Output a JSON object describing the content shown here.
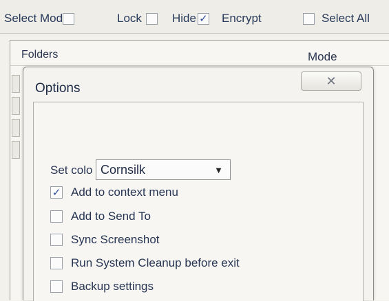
{
  "toolbar": {
    "items": [
      {
        "label": "Select Mod",
        "checked": false
      },
      {
        "label": "Lock",
        "checked": false
      },
      {
        "label": "Hide",
        "checked": true
      },
      {
        "label": "Encrypt",
        "checked": false
      },
      {
        "label": "Select All",
        "checked": false
      }
    ]
  },
  "table": {
    "col_folders": "Folders",
    "col_mode": "Mode"
  },
  "dialog": {
    "title": "Options",
    "close_glyph": "✕",
    "set_color_label": "Set colo",
    "color_value": "Cornsilk",
    "options": [
      {
        "label": "Add to context menu",
        "checked": true
      },
      {
        "label": "Add to Send To",
        "checked": false
      },
      {
        "label": "Sync Screenshot",
        "checked": false
      },
      {
        "label": "Run System Cleanup before exit",
        "checked": false
      },
      {
        "label": "Backup settings",
        "checked": false
      }
    ]
  },
  "check_glyph": "✓"
}
